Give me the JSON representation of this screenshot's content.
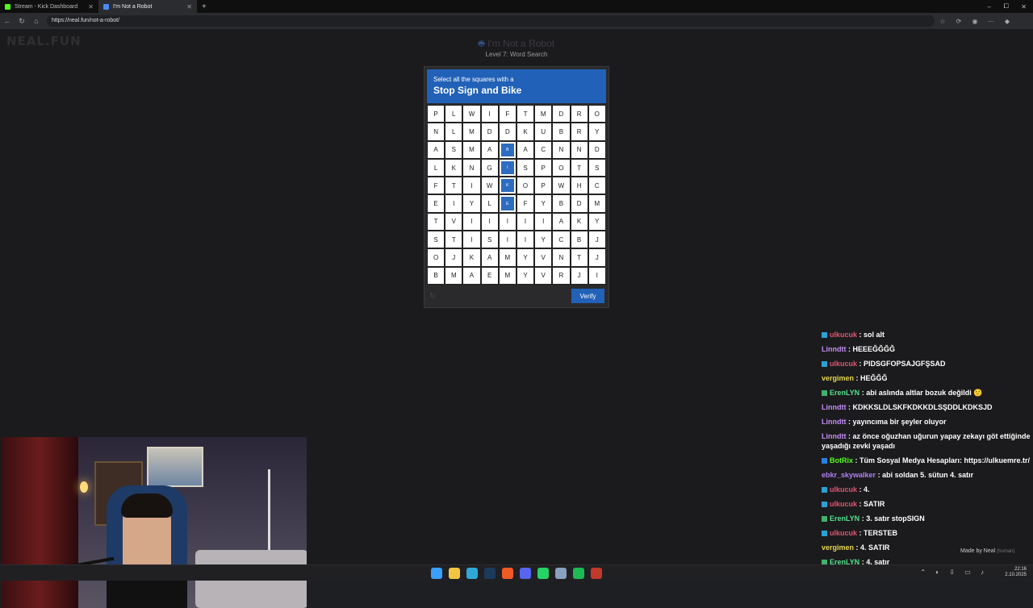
{
  "browser": {
    "tabs": [
      {
        "title": "Stream - Kick Dashboard",
        "favicon_color": "#53fc18"
      },
      {
        "title": "I'm Not a Robot",
        "favicon_color": "#4a8cf7"
      }
    ],
    "new_tab": "+",
    "url": "https://neal.fun/not-a-robot/",
    "controls": {
      "minimize": "–",
      "maximize": "⧠",
      "close": "✕"
    }
  },
  "page": {
    "logo": "NEAL.FUN",
    "title": "I'm Not a Robot",
    "level": "Level 7: Word Search",
    "captcha": {
      "instruction": "Select all the squares with a",
      "target": "Stop Sign and Bike",
      "verify_label": "Verify",
      "refresh_icon": "↻",
      "grid": [
        [
          "P",
          "L",
          "W",
          "I",
          "F",
          "T",
          "M",
          "D",
          "R",
          "O"
        ],
        [
          "N",
          "L",
          "M",
          "D",
          "D",
          "K",
          "U",
          "B",
          "R",
          "Y"
        ],
        [
          "A",
          "S",
          "M",
          "A",
          "B",
          "A",
          "C",
          "N",
          "N",
          "D"
        ],
        [
          "L",
          "K",
          "N",
          "G",
          "I",
          "S",
          "P",
          "O",
          "T",
          "S"
        ],
        [
          "F",
          "T",
          "I",
          "W",
          "K",
          "O",
          "P",
          "W",
          "H",
          "C"
        ],
        [
          "E",
          "I",
          "Y",
          "L",
          "E",
          "F",
          "Y",
          "B",
          "D",
          "M"
        ],
        [
          "T",
          "V",
          "I",
          "I",
          "I",
          "I",
          "I",
          "A",
          "K",
          "Y"
        ],
        [
          "S",
          "T",
          "I",
          "S",
          "I",
          "I",
          "Y",
          "C",
          "B",
          "J"
        ],
        [
          "O",
          "J",
          "K",
          "A",
          "M",
          "Y",
          "V",
          "N",
          "T",
          "J"
        ],
        [
          "B",
          "M",
          "A",
          "E",
          "M",
          "Y",
          "V",
          "R",
          "J",
          "I"
        ]
      ],
      "selected": [
        [
          2,
          4
        ],
        [
          3,
          4
        ],
        [
          4,
          4
        ],
        [
          5,
          4
        ]
      ]
    },
    "made_by": "Made by Neal",
    "made_by_tag": "(human)"
  },
  "chat": [
    {
      "user": "ulkucuk",
      "color": "#e0556f",
      "badge": "#2aa1d6",
      "text": "sol alt"
    },
    {
      "user": "Linndtt",
      "color": "#c28cf5",
      "badge": "",
      "text": "HEEEĞĞĞĞ"
    },
    {
      "user": "ulkucuk",
      "color": "#e0556f",
      "badge": "#2aa1d6",
      "text": "PIDSGFOPSAJGFŞSAD"
    },
    {
      "user": "vergimen",
      "color": "#e6d84a",
      "badge": "",
      "text": "HEĞĞĞ"
    },
    {
      "user": "ErenLYN",
      "color": "#53e08a",
      "badge": "#3fb36a",
      "text": "abi aslında altlar bozuk değildi 🙂"
    },
    {
      "user": "Linndtt",
      "color": "#c28cf5",
      "badge": "",
      "text": "KDKKSLDLSKFKDKKDLSŞDDLKDKSJD"
    },
    {
      "user": "Linndtt",
      "color": "#c28cf5",
      "badge": "",
      "text": "yayıncıma bir şeyler oluyor"
    },
    {
      "user": "Linndtt",
      "color": "#c28cf5",
      "badge": "",
      "text": "az önce oğuzhan uğurun yapay zekayı göt ettiğinde yaşadığı zevki yaşadı"
    },
    {
      "user": "BotRix",
      "color": "#53fc18",
      "badge": "#2a7ee0",
      "text": "Tüm Sosyal Medya Hesapları: https://ulkuemre.tr/"
    },
    {
      "user": "ebkr_skywalker",
      "color": "#b080f0",
      "badge": "",
      "text": "abi soldan 5. sütun 4. satır"
    },
    {
      "user": "ulkucuk",
      "color": "#e0556f",
      "badge": "#2aa1d6",
      "text": "4."
    },
    {
      "user": "ulkucuk",
      "color": "#e0556f",
      "badge": "#2aa1d6",
      "text": "SATIR"
    },
    {
      "user": "ErenLYN",
      "color": "#53e08a",
      "badge": "#3fb36a",
      "text": "3. satır stopSIGN"
    },
    {
      "user": "ulkucuk",
      "color": "#e0556f",
      "badge": "#2aa1d6",
      "text": "TERSTEB"
    },
    {
      "user": "vergimen",
      "color": "#e6d84a",
      "badge": "",
      "text": "4. SATIR"
    },
    {
      "user": "ErenLYN",
      "color": "#53e08a",
      "badge": "#3fb36a",
      "text": "4. satır"
    }
  ],
  "taskbar": {
    "time": "22:16",
    "date": "2.10.2025",
    "apps": [
      {
        "name": "windows-start-icon",
        "color": "#3aa0ff"
      },
      {
        "name": "file-explorer-icon",
        "color": "#f5c542"
      },
      {
        "name": "edge-icon",
        "color": "#2fa8d8"
      },
      {
        "name": "steam-icon",
        "color": "#1b3a5c"
      },
      {
        "name": "brave-icon",
        "color": "#f05a24"
      },
      {
        "name": "discord-icon",
        "color": "#5865f2"
      },
      {
        "name": "whatsapp-icon",
        "color": "#25d366"
      },
      {
        "name": "gamepad-icon",
        "color": "#8aa0c0"
      },
      {
        "name": "spotify-icon",
        "color": "#1db954"
      },
      {
        "name": "obs-icon",
        "color": "#c0392b"
      }
    ]
  }
}
